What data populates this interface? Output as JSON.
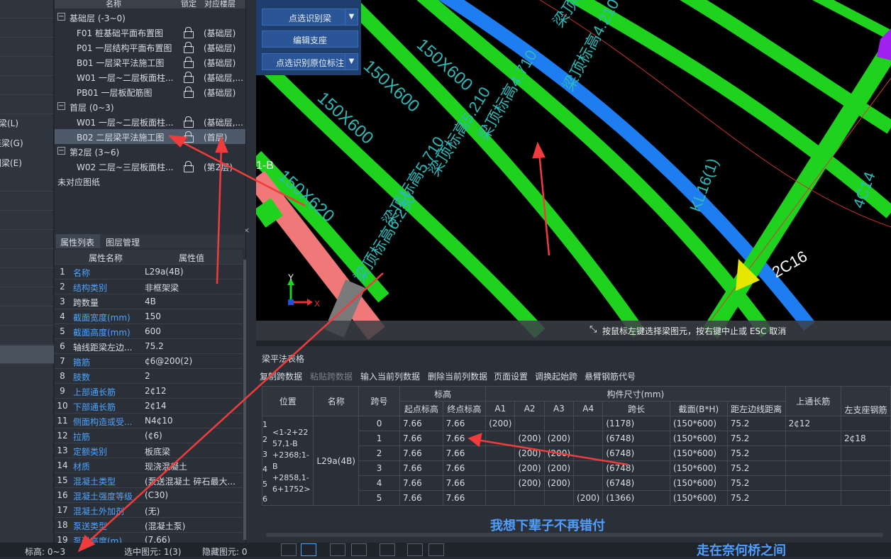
{
  "left_strip": {
    "items": [
      "梁(L)",
      "连梁(G)",
      "圈梁(E)"
    ]
  },
  "drawing_panel": {
    "columns": {
      "name": "名称",
      "lock": "锁定",
      "floor": "对应楼层"
    },
    "groups": [
      {
        "label": "基础层 (-3~0)",
        "items": [
          {
            "name": "F01 桩基础平面布置图",
            "floor": "(基础层)"
          },
          {
            "name": "P01 一层结构平面布置图",
            "floor": "(基础层)"
          },
          {
            "name": "B01 一层梁平法施工图",
            "floor": "(基础层)"
          },
          {
            "name": "W01 一层~二层板面柱...",
            "floor": "(基础层,..."
          },
          {
            "name": "PB01 一层板配筋图",
            "floor": "(基础层)"
          }
        ]
      },
      {
        "label": "首层 (0~3)",
        "items": [
          {
            "name": "W01 一层~二层板面柱...",
            "floor": "(基础层,..."
          },
          {
            "name": "B02 二层梁平法施工图",
            "floor": "(首层)"
          }
        ]
      },
      {
        "label": "第2层 (3~6)",
        "items": [
          {
            "name": "W02 二层~三层板面柱...",
            "floor": "(第2层)"
          }
        ]
      }
    ],
    "unmatched": "未对应图纸"
  },
  "props": {
    "tabs": [
      "属性列表",
      "图层管理"
    ],
    "headers": [
      "属性名称",
      "属性值"
    ],
    "rows": [
      {
        "n": "1",
        "k": "名称",
        "v": "L29a(4B)",
        "blue": true
      },
      {
        "n": "2",
        "k": "结构类别",
        "v": "非框架梁",
        "blue": true
      },
      {
        "n": "3",
        "k": "跨数量",
        "v": "4B",
        "blue": false
      },
      {
        "n": "4",
        "k": "截面宽度(mm)",
        "v": "150",
        "blue": true
      },
      {
        "n": "5",
        "k": "截面高度(mm)",
        "v": "600",
        "blue": true
      },
      {
        "n": "6",
        "k": "轴线距梁左边...",
        "v": "75.2",
        "blue": false
      },
      {
        "n": "7",
        "k": "箍筋",
        "v": "¢6@200(2)",
        "blue": true
      },
      {
        "n": "8",
        "k": "肢数",
        "v": "2",
        "blue": true
      },
      {
        "n": "9",
        "k": "上部通长筋",
        "v": "2¢12",
        "blue": true
      },
      {
        "n": "10",
        "k": "下部通长筋",
        "v": "2¢14",
        "blue": true
      },
      {
        "n": "11",
        "k": "侧面构造或受...",
        "v": "N4¢10",
        "blue": true
      },
      {
        "n": "12",
        "k": "拉筋",
        "v": "(¢6)",
        "blue": true
      },
      {
        "n": "13",
        "k": "定额类别",
        "v": "板底梁",
        "blue": true
      },
      {
        "n": "14",
        "k": "材质",
        "v": "现浇混凝土",
        "blue": true
      },
      {
        "n": "15",
        "k": "混凝土类型",
        "v": "(泵送混凝土 碎石最大...",
        "blue": true
      },
      {
        "n": "16",
        "k": "混凝土强度等级",
        "v": "(C30)",
        "blue": true
      },
      {
        "n": "17",
        "k": "混凝土外加剂",
        "v": "(无)",
        "blue": true
      },
      {
        "n": "18",
        "k": "泵送类型",
        "v": "(混凝土泵)",
        "blue": true
      },
      {
        "n": "19",
        "k": "泵送高度(m)",
        "v": "(7.66)",
        "blue": true
      }
    ]
  },
  "canvas_buttons": [
    {
      "label": "点选识别梁",
      "dd": true
    },
    {
      "label": "编辑支座",
      "dd": false
    },
    {
      "label": "点选识别原位标注",
      "dd": true
    }
  ],
  "canvas_text": {
    "sizes": [
      "150X600",
      "150X600",
      "150X600",
      "150X620"
    ],
    "elevs": [
      "梁顶标高3.580",
      "梁顶标高4.210",
      "梁顶标高4.710",
      "梁顶标高5.210",
      "梁顶标高5.710",
      "梁顶标高6.230"
    ],
    "axis": "1-B",
    "beam": "KL16(1)",
    "rebar": "2C16",
    "rebar2": "4C14",
    "axis_y": "Y",
    "axis_x": "X"
  },
  "hint": "按鼠标左键选择梁图元，按右键中止或 ESC 取消",
  "beam_table": {
    "title": "梁平法表格",
    "toolbar": [
      "复制跨数据",
      "粘贴跨数据",
      "输入当前列数据",
      "删除当前列数据",
      "页面设置",
      "调换起始跨",
      "悬臂钢筋代号"
    ],
    "headers": {
      "pos": "位置",
      "name": "名称",
      "span": "跨号",
      "elev": "标高",
      "start": "起点标高",
      "end": "终点标高",
      "dims": "构件尺寸(mm)",
      "a1": "A1",
      "a2": "A2",
      "a3": "A3",
      "a4": "A4",
      "len": "跨长",
      "sec": "截面(B*H)",
      "edge": "距左边线距离",
      "top": "上通长筋",
      "left": "左支座钢筋"
    },
    "pos_lines": [
      "<1-2+22",
      "57,1-B",
      "+2368;1-",
      "B",
      "+2858,1-",
      "6+1752>"
    ],
    "beam_name": "L29a(4B)",
    "rows": [
      {
        "i": "1",
        "span": "0",
        "s": "7.66",
        "e": "7.66",
        "a1": "(200)",
        "a2": "",
        "a3": "",
        "a4": "",
        "len": "(1178)",
        "sec": "(150*600)",
        "edge": "75.2",
        "top": "2¢12",
        "left": ""
      },
      {
        "i": "2",
        "span": "1",
        "s": "7.66",
        "e": "7.66",
        "a1": "",
        "a2": "(200)",
        "a3": "(200)",
        "a4": "",
        "len": "(6748)",
        "sec": "(150*600)",
        "edge": "75.2",
        "top": "",
        "left": "2¢18"
      },
      {
        "i": "3",
        "span": "2",
        "s": "7.66",
        "e": "7.66",
        "a1": "",
        "a2": "(200)",
        "a3": "(200)",
        "a4": "",
        "len": "(6748)",
        "sec": "(150*600)",
        "edge": "75.2",
        "top": "",
        "left": ""
      },
      {
        "i": "4",
        "span": "3",
        "s": "7.66",
        "e": "7.66",
        "a1": "",
        "a2": "(200)",
        "a3": "(200)",
        "a4": "",
        "len": "(6748)",
        "sec": "(150*600)",
        "edge": "75.2",
        "top": "",
        "left": ""
      },
      {
        "i": "5",
        "span": "4",
        "s": "7.66",
        "e": "7.66",
        "a1": "",
        "a2": "(200)",
        "a3": "(200)",
        "a4": "",
        "len": "(6748)",
        "sec": "(150*600)",
        "edge": "75.2",
        "top": "",
        "left": ""
      },
      {
        "i": "6",
        "span": "5",
        "s": "7.66",
        "e": "7.66",
        "a1": "",
        "a2": "",
        "a3": "",
        "a4": "(200)",
        "len": "(1366)",
        "sec": "(150*600)",
        "edge": "75.2",
        "top": "",
        "left": ""
      }
    ]
  },
  "subtitles": [
    "我想下辈子不再错付",
    "走在奈何桥之间"
  ],
  "status": {
    "elev": "标高:  0~3",
    "selected": "选中图元: 1(3)",
    "hidden": "隐藏图元: 0"
  },
  "colors": {
    "beam_green": "#1ed21e",
    "beam_blue": "#1e7df0",
    "beam_pink": "#f07878",
    "annotation_arrow": "#f03c3c"
  }
}
